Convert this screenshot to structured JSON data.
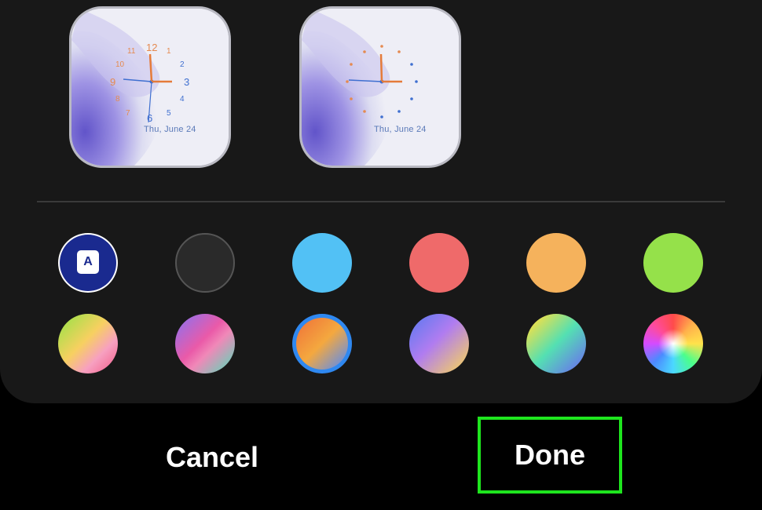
{
  "clock_previews": [
    {
      "style": "numbers",
      "date_label": "Thu, June 24",
      "numbers": [
        "12",
        "1",
        "2",
        "3",
        "4",
        "5",
        "6",
        "7",
        "8",
        "9",
        "10",
        "11"
      ]
    },
    {
      "style": "dots",
      "date_label": "Thu, June 24"
    }
  ],
  "color_options": {
    "row1": [
      {
        "name": "auto-theme",
        "color": "#1a2a8f",
        "label": "A"
      },
      {
        "name": "black",
        "color": "#2a2a2a"
      },
      {
        "name": "blue",
        "color": "#52c1f5"
      },
      {
        "name": "red",
        "color": "#ef6a6a"
      },
      {
        "name": "orange",
        "color": "#f5b25c"
      },
      {
        "name": "green",
        "color": "#95e14a"
      }
    ],
    "row2": [
      {
        "name": "gradient-green-pink",
        "colors": [
          "#a6e04a",
          "#f7a0c0",
          "#f2648f"
        ]
      },
      {
        "name": "gradient-purple-pink-teal",
        "colors": [
          "#9a6ee5",
          "#ea5aa8",
          "#5fd6b9"
        ]
      },
      {
        "name": "gradient-orange-blue",
        "colors": [
          "#f07b3a",
          "#f4a83f",
          "#5b8cf0"
        ],
        "selected": true
      },
      {
        "name": "gradient-blue-yellow",
        "colors": [
          "#6a7af0",
          "#b07cf0",
          "#f6d25f"
        ]
      },
      {
        "name": "gradient-yellow-teal",
        "colors": [
          "#f3e046",
          "#54e0b2",
          "#6a6ef0"
        ]
      },
      {
        "name": "gradient-rainbow",
        "colors": [
          "#ff4b4b",
          "#ffe24b",
          "#4bff8a",
          "#4b8bff",
          "#d44bff"
        ]
      }
    ],
    "selected_ring_color": "#2f88f0"
  },
  "buttons": {
    "cancel": "Cancel",
    "done": "Done"
  },
  "highlight_color": "#1ee51e"
}
